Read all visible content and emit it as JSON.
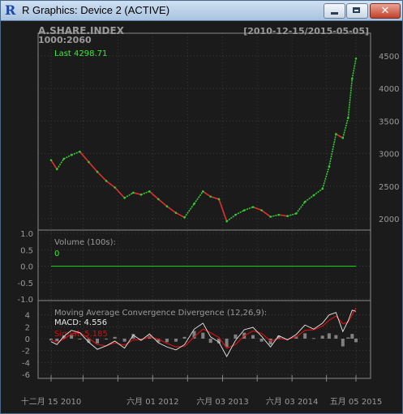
{
  "window": {
    "title": "R Graphics: Device 2 (ACTIVE)",
    "icon": "r-logo-icon",
    "controls": {
      "minimize": "minimize-icon",
      "maximize": "maximize-icon",
      "close": "close-icon"
    }
  },
  "colors": {
    "price_up": "#33cc33",
    "price_down": "#e03030",
    "volume": "#00dd00",
    "macd": "#e8e8e8",
    "signal": "#d01010",
    "histogram": "#808080",
    "grid": "#3a3a3a",
    "text": "#9a9a9a",
    "background": "#1b1b1b"
  },
  "chart_data": [
    {
      "type": "line",
      "panel": "price",
      "title": "A.SHARE.INDEX",
      "subtitle": "1000:2060",
      "date_range": "[2010-12-15/2015-05-05]",
      "last_label": "Last 4298.71",
      "ylim": [
        1900,
        4600
      ],
      "yticks": [
        2000,
        2500,
        3000,
        3500,
        4000,
        4500
      ],
      "xticks": [
        "十二月 15 2010",
        "六月 01 2012",
        "六月 03 2013",
        "六月 03 2014",
        "五月 05 2015"
      ],
      "x": [
        "2010-12-15",
        "2011-01-15",
        "2011-02-20",
        "2011-04-01",
        "2011-05-15",
        "2011-07-01",
        "2011-08-15",
        "2011-10-01",
        "2011-11-15",
        "2012-01-05",
        "2012-02-20",
        "2012-04-01",
        "2012-05-15",
        "2012-07-01",
        "2012-08-15",
        "2012-10-01",
        "2012-11-15",
        "2013-01-05",
        "2013-02-20",
        "2013-04-01",
        "2013-05-15",
        "2013-06-25",
        "2013-08-10",
        "2013-09-25",
        "2013-11-10",
        "2013-12-25",
        "2014-02-10",
        "2014-03-25",
        "2014-05-10",
        "2014-06-25",
        "2014-08-10",
        "2014-09-25",
        "2014-11-10",
        "2014-12-15",
        "2015-01-20",
        "2015-02-25",
        "2015-03-25",
        "2015-04-15",
        "2015-05-05"
      ],
      "values": [
        2900,
        2760,
        2920,
        2980,
        3030,
        2870,
        2720,
        2580,
        2480,
        2320,
        2400,
        2370,
        2420,
        2300,
        2190,
        2090,
        2020,
        2230,
        2420,
        2340,
        2300,
        1960,
        2060,
        2130,
        2180,
        2130,
        2030,
        2060,
        2040,
        2080,
        2260,
        2360,
        2460,
        2800,
        3300,
        3240,
        3550,
        4150,
        4460
      ]
    },
    {
      "type": "bar",
      "panel": "volume",
      "label": "Volume (100s):",
      "last_value": "0",
      "ylim": [
        -1.0,
        1.0
      ],
      "yticks": [
        "1.0",
        "0.5",
        "0.0",
        "-0.5",
        "-1.0"
      ],
      "values": [
        0,
        0,
        0,
        0,
        0,
        0,
        0,
        0,
        0,
        0,
        0,
        0,
        0,
        0,
        0,
        0,
        0,
        0,
        0,
        0,
        0,
        0,
        0,
        0,
        0,
        0,
        0,
        0,
        0,
        0,
        0,
        0,
        0,
        0,
        0,
        0,
        0,
        0,
        0
      ]
    },
    {
      "type": "line",
      "panel": "macd",
      "label": "Moving Average Convergence Divergence (12,26,9):",
      "macd_label": "MACD: 4.556",
      "signal_label": "Signal: 5.185",
      "ylim": [
        -6,
        6
      ],
      "yticks": [
        4,
        2,
        0,
        -2,
        -4,
        -6
      ],
      "macd": [
        -0.5,
        -1.0,
        0.4,
        1.4,
        1.0,
        -0.6,
        -1.8,
        -1.2,
        -0.4,
        -1.6,
        0.6,
        -0.3,
        0.8,
        -0.7,
        -1.4,
        -1.9,
        -1.0,
        1.6,
        2.6,
        0.3,
        -0.6,
        -3.0,
        -0.3,
        1.5,
        1.9,
        0.4,
        -1.4,
        0.5,
        -0.2,
        0.7,
        2.3,
        1.6,
        2.6,
        4.0,
        4.4,
        1.2,
        3.0,
        4.8,
        4.6
      ],
      "signal": [
        -0.2,
        -0.6,
        -0.1,
        0.8,
        1.0,
        0.1,
        -1.0,
        -1.2,
        -0.7,
        -1.1,
        -0.2,
        -0.2,
        0.3,
        -0.1,
        -0.8,
        -1.4,
        -1.3,
        0.3,
        1.6,
        1.0,
        0.2,
        -1.6,
        -1.0,
        0.5,
        1.3,
        0.9,
        -0.4,
        0.0,
        -0.1,
        0.3,
        1.4,
        1.5,
        2.1,
        3.1,
        3.8,
        2.5,
        2.8,
        4.0,
        5.2
      ]
    }
  ]
}
